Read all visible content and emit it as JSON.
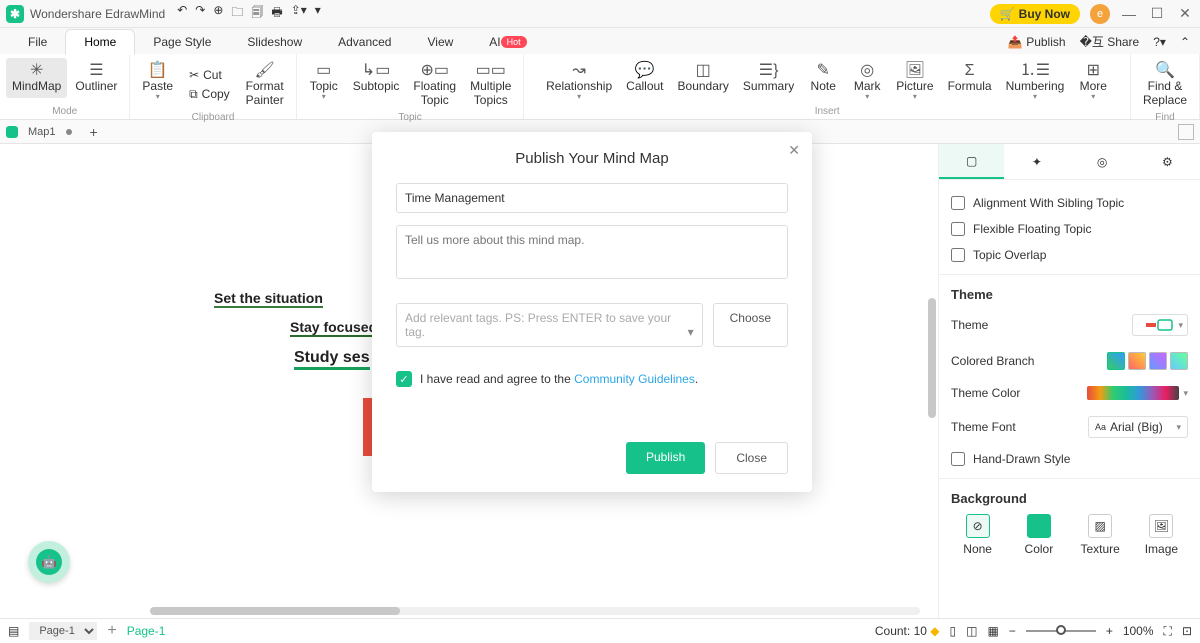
{
  "titlebar": {
    "app_name": "Wondershare EdrawMind",
    "buy": "Buy Now",
    "avatar_initial": "e"
  },
  "menubar": {
    "tabs": [
      "File",
      "Home",
      "Page Style",
      "Slideshow",
      "Advanced",
      "View",
      "AI"
    ],
    "hot": "Hot",
    "publish": "Publish",
    "share": "Share"
  },
  "ribbon": {
    "mode": {
      "label": "Mode",
      "mindmap": "MindMap",
      "outliner": "Outliner"
    },
    "clipboard": {
      "label": "Clipboard",
      "paste": "Paste",
      "cut": "Cut",
      "copy": "Copy",
      "format": "Format\nPainter"
    },
    "topic": {
      "label": "Topic",
      "topic": "Topic",
      "subtopic": "Subtopic",
      "floating": "Floating\nTopic",
      "multiple": "Multiple\nTopics"
    },
    "insert": {
      "label": "Insert",
      "relationship": "Relationship",
      "callout": "Callout",
      "boundary": "Boundary",
      "summary": "Summary",
      "note": "Note",
      "mark": "Mark",
      "picture": "Picture",
      "formula": "Formula",
      "numbering": "Numbering",
      "more": "More"
    },
    "find": {
      "label": "Find",
      "findreplace": "Find &\nReplace"
    }
  },
  "doctabs": {
    "name": "Map1"
  },
  "canvas": {
    "t1": "Set the situation",
    "t2": "Stay focused",
    "t3": "Study ses"
  },
  "dialog": {
    "title": "Publish Your Mind Map",
    "name_value": "Time Management",
    "desc_placeholder": "Tell us more about this mind map.",
    "tags_placeholder": "Add relevant tags. PS: Press ENTER to save your tag.",
    "choose": "Choose",
    "agree_prefix": "I have read and agree to the ",
    "agree_link": "Community Guidelines",
    "publish": "Publish",
    "close": "Close"
  },
  "right": {
    "align": "Alignment With Sibling Topic",
    "flex": "Flexible Floating Topic",
    "overlap": "Topic Overlap",
    "theme_h": "Theme",
    "theme": "Theme",
    "colored_branch": "Colored Branch",
    "theme_color": "Theme Color",
    "theme_font": "Theme Font",
    "font_value": "Arial (Big)",
    "handdrawn": "Hand-Drawn Style",
    "background_h": "Background",
    "bg": {
      "none": "None",
      "color": "Color",
      "texture": "Texture",
      "image": "Image"
    }
  },
  "status": {
    "page_sel": "Page-1",
    "page_lbl": "Page-1",
    "count_lbl": "Count:",
    "count_val": "10",
    "zoom": "100%"
  }
}
